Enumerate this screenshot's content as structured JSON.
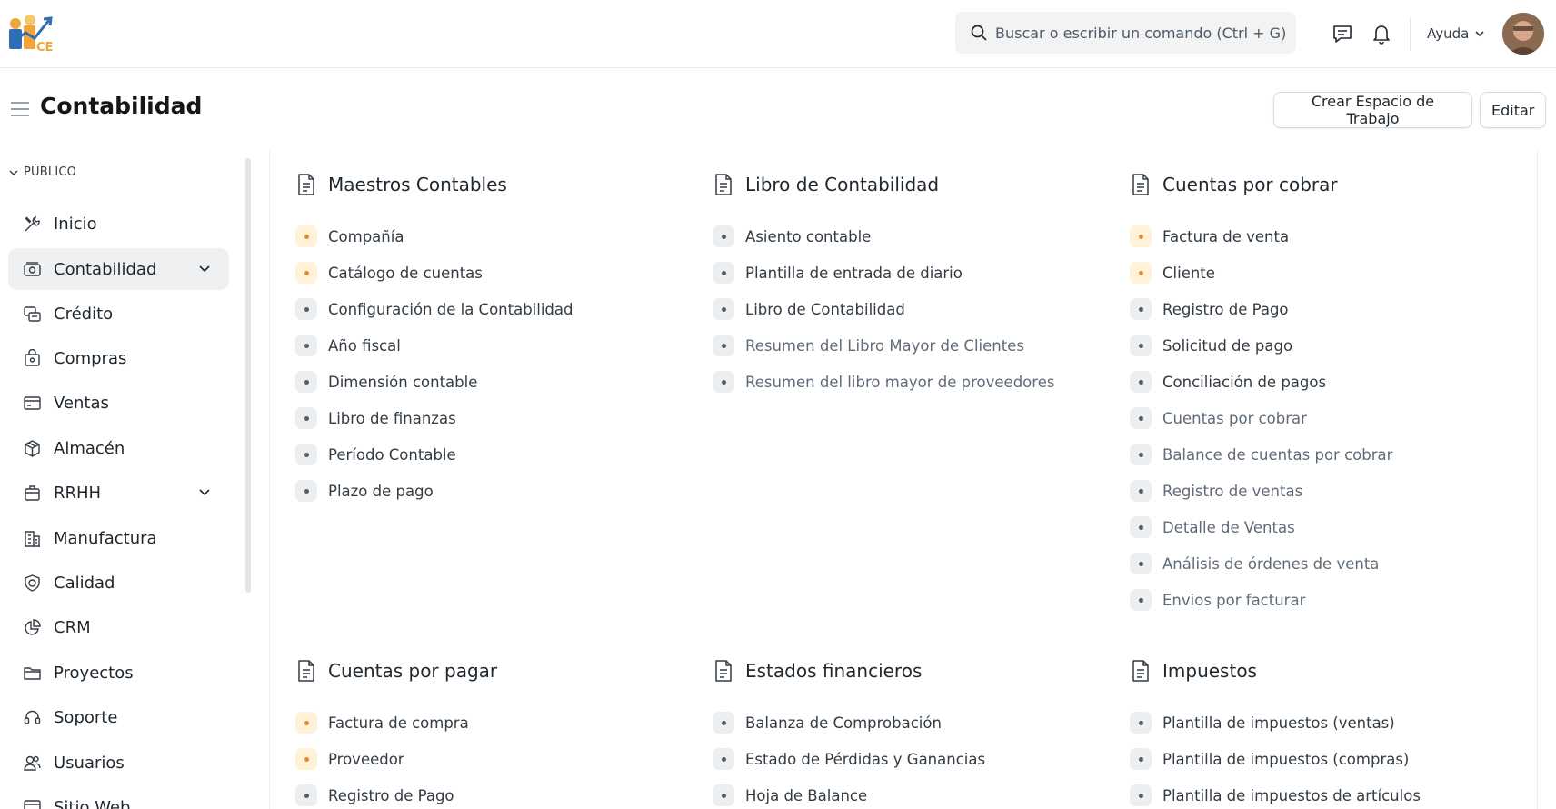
{
  "brand": {
    "logo_text": "CE"
  },
  "search": {
    "placeholder": "Buscar o escribir un comando (Ctrl + G)"
  },
  "navbar": {
    "help_label": "Ayuda"
  },
  "page": {
    "title": "Contabilidad",
    "create_workspace_label": "Crear Espacio de Trabajo",
    "edit_label": "Editar"
  },
  "sidebar": {
    "section_label": "PÚBLICO",
    "items": [
      {
        "label": "Inicio",
        "icon": "tools-icon"
      },
      {
        "label": "Contabilidad",
        "icon": "accounting-icon",
        "active": true,
        "expandable": true
      },
      {
        "label": "Crédito",
        "icon": "credit-icon"
      },
      {
        "label": "Compras",
        "icon": "purchase-icon"
      },
      {
        "label": "Ventas",
        "icon": "sales-icon"
      },
      {
        "label": "Almacén",
        "icon": "stock-icon"
      },
      {
        "label": "RRHH",
        "icon": "hr-icon",
        "expandable": true
      },
      {
        "label": "Manufactura",
        "icon": "factory-icon"
      },
      {
        "label": "Calidad",
        "icon": "quality-icon"
      },
      {
        "label": "CRM",
        "icon": "crm-icon"
      },
      {
        "label": "Proyectos",
        "icon": "folder-icon"
      },
      {
        "label": "Soporte",
        "icon": "headset-icon"
      },
      {
        "label": "Usuarios",
        "icon": "users-icon"
      },
      {
        "label": "Sitio Web",
        "icon": "website-icon"
      }
    ]
  },
  "cards": [
    {
      "title": "Maestros Contables",
      "links": [
        {
          "label": "Compañía",
          "accent": "orange"
        },
        {
          "label": "Catálogo de cuentas",
          "accent": "orange"
        },
        {
          "label": "Configuración de la Contabilidad",
          "accent": "gray"
        },
        {
          "label": "Año fiscal",
          "accent": "gray"
        },
        {
          "label": "Dimensión contable",
          "accent": "gray"
        },
        {
          "label": "Libro de finanzas",
          "accent": "gray"
        },
        {
          "label": "Período Contable",
          "accent": "gray"
        },
        {
          "label": "Plazo de pago",
          "accent": "gray"
        }
      ]
    },
    {
      "title": "Libro de Contabilidad",
      "links": [
        {
          "label": "Asiento contable",
          "accent": "gray"
        },
        {
          "label": "Plantilla de entrada de diario",
          "accent": "gray"
        },
        {
          "label": "Libro de Contabilidad",
          "accent": "gray"
        },
        {
          "label": "Resumen del Libro Mayor de Clientes",
          "accent": "gray",
          "muted": true
        },
        {
          "label": "Resumen del libro mayor de proveedores",
          "accent": "gray",
          "muted": true
        }
      ]
    },
    {
      "title": "Cuentas por cobrar",
      "links": [
        {
          "label": "Factura de venta",
          "accent": "orange"
        },
        {
          "label": "Cliente",
          "accent": "orange"
        },
        {
          "label": "Registro de Pago",
          "accent": "gray"
        },
        {
          "label": "Solicitud de pago",
          "accent": "gray"
        },
        {
          "label": "Conciliación de pagos",
          "accent": "gray"
        },
        {
          "label": "Cuentas por cobrar",
          "accent": "gray",
          "muted": true
        },
        {
          "label": "Balance de cuentas por cobrar",
          "accent": "gray",
          "muted": true
        },
        {
          "label": "Registro de ventas",
          "accent": "gray",
          "muted": true
        },
        {
          "label": "Detalle de Ventas",
          "accent": "gray",
          "muted": true
        },
        {
          "label": "Análisis de órdenes de venta",
          "accent": "gray",
          "muted": true
        },
        {
          "label": "Envios por facturar",
          "accent": "gray",
          "muted": true
        }
      ]
    },
    {
      "title": "Cuentas por pagar",
      "links": [
        {
          "label": "Factura de compra",
          "accent": "orange"
        },
        {
          "label": "Proveedor",
          "accent": "orange"
        },
        {
          "label": "Registro de Pago",
          "accent": "gray"
        }
      ]
    },
    {
      "title": "Estados financieros",
      "links": [
        {
          "label": "Balanza de Comprobación",
          "accent": "gray"
        },
        {
          "label": "Estado de Pérdidas y Ganancias",
          "accent": "gray"
        },
        {
          "label": "Hoja de Balance",
          "accent": "gray"
        }
      ]
    },
    {
      "title": "Impuestos",
      "links": [
        {
          "label": "Plantilla de impuestos (ventas)",
          "accent": "gray"
        },
        {
          "label": "Plantilla de impuestos (compras)",
          "accent": "gray"
        },
        {
          "label": "Plantilla de impuestos de artículos",
          "accent": "gray"
        }
      ]
    }
  ]
}
